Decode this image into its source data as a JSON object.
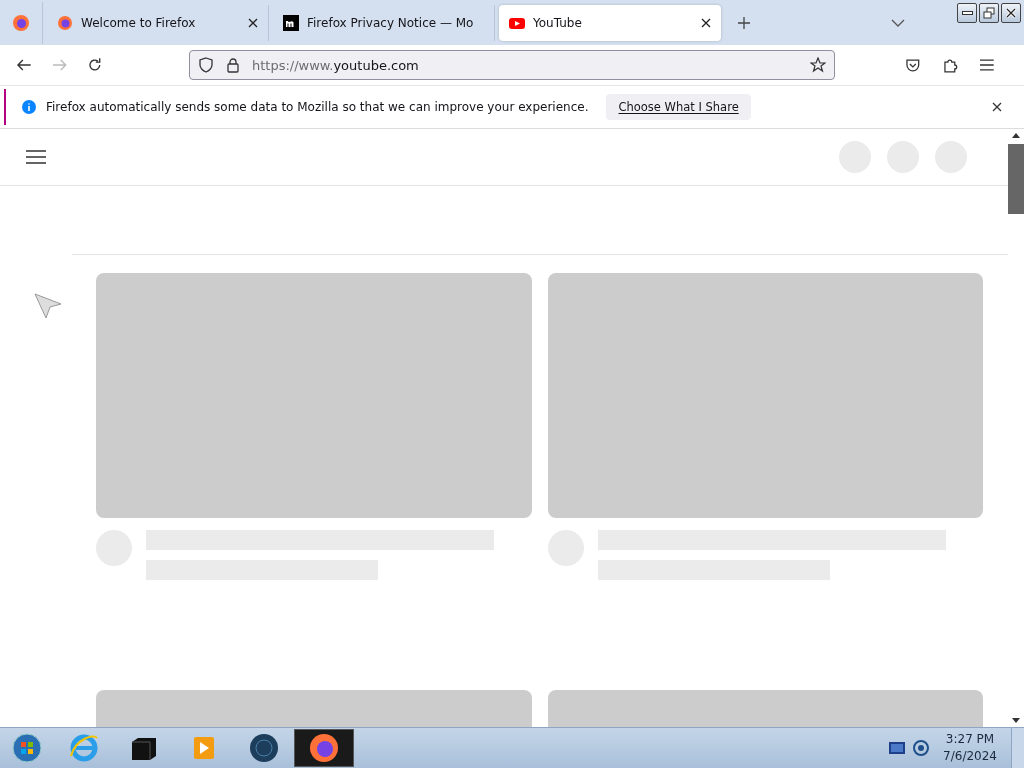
{
  "tabs": [
    {
      "title": "Welcome to Firefox",
      "selected": false
    },
    {
      "title": "Firefox Privacy Notice — Mo",
      "selected": false
    },
    {
      "title": "YouTube",
      "selected": true
    }
  ],
  "toolbar": {
    "back": {
      "disabled": false
    },
    "forward": {
      "disabled": true
    },
    "url_prefix": "https://www.",
    "url_host": "youtube.com"
  },
  "notification": {
    "text": "Firefox automatically sends some data to Mozilla so that we can improve your experience.",
    "button": "Choose What I Share"
  },
  "taskbar": {
    "apps": [
      {
        "kind": "ie",
        "selected": false
      },
      {
        "kind": "box",
        "selected": false
      },
      {
        "kind": "media",
        "selected": false
      },
      {
        "kind": "globe",
        "selected": false
      },
      {
        "kind": "firefox",
        "selected": true
      }
    ],
    "time": "3:27 PM",
    "date": "7/6/2024"
  }
}
